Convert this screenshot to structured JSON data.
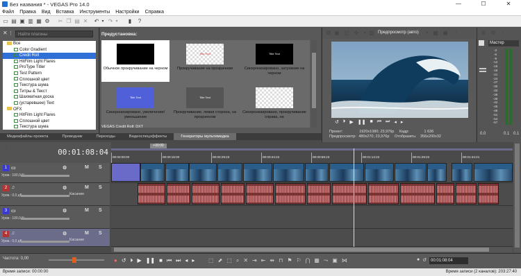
{
  "window": {
    "title": "Без названия * - VEGAS Pro 14.0",
    "controls": [
      "—",
      "☐",
      "✕"
    ]
  },
  "menu": [
    "Файл",
    "Правка",
    "Вид",
    "Вставка",
    "Инструменты",
    "Настройки",
    "Справка"
  ],
  "explorer": {
    "search_placeholder": "Найти плагины",
    "tree": [
      {
        "label": "Все",
        "type": "folder",
        "indent": 1,
        "sel": false
      },
      {
        "label": "Color Gradient",
        "type": "fx",
        "indent": 2,
        "sel": false
      },
      {
        "label": "Credit Roll",
        "type": "fx",
        "indent": 2,
        "sel": true
      },
      {
        "label": "HitFilm Light Flares",
        "type": "fx",
        "indent": 2,
        "sel": false
      },
      {
        "label": "ProType Titler",
        "type": "fx",
        "indent": 2,
        "sel": false
      },
      {
        "label": "Test Pattern",
        "type": "fx",
        "indent": 2,
        "sel": false
      },
      {
        "label": "Сплошной цвет",
        "type": "fx",
        "indent": 2,
        "sel": false
      },
      {
        "label": "Текстура шума",
        "type": "fx",
        "indent": 2,
        "sel": false
      },
      {
        "label": "Титры & Текст",
        "type": "fx",
        "indent": 2,
        "sel": false
      },
      {
        "label": "Шахматная доска",
        "type": "fx",
        "indent": 2,
        "sel": false
      },
      {
        "label": "(устаревшее) Text",
        "type": "fx",
        "indent": 2,
        "sel": false
      },
      {
        "label": "OFX",
        "type": "folder",
        "indent": 1,
        "sel": false
      },
      {
        "label": "HitFilm Light Flares",
        "type": "fx",
        "indent": 2,
        "sel": false
      },
      {
        "label": "Сплошной цвет",
        "type": "fx",
        "indent": 2,
        "sel": false
      },
      {
        "label": "Текстура шума",
        "type": "fx",
        "indent": 2,
        "sel": false
      }
    ]
  },
  "presets": {
    "header": "Предустановка:",
    "status": "VEGAS Credit Roll: DXT",
    "items": [
      {
        "label": "Обычное прокручивание на черном",
        "thumb": "black",
        "thumb_text": "",
        "sel": true
      },
      {
        "label": "Прокручивание на прозрачном",
        "thumb": "checker",
        "thumb_text": "Title Text",
        "sel": false
      },
      {
        "label": "Синхронизировано, затухание на черном",
        "thumb": "black",
        "thumb_text": "Title Text",
        "sel": false
      },
      {
        "label": "Синхронизировано, увеличение/уменьшение",
        "thumb": "blue",
        "thumb_text": "Title Text",
        "sel": false
      },
      {
        "label": "Прокручивание, левая сторона, на прозрачном",
        "thumb": "gray",
        "thumb_text": "Title Text",
        "sel": false
      },
      {
        "label": "Синхронизировано, прокручивание справа, на",
        "thumb": "checker",
        "thumb_text": "",
        "sel": false
      }
    ]
  },
  "tabs": [
    {
      "label": "Медиафайлы проекта",
      "on": false
    },
    {
      "label": "Проводник",
      "on": false
    },
    {
      "label": "Переходы",
      "on": false
    },
    {
      "label": "Видеоспецэффекты",
      "on": false
    },
    {
      "label": "Генераторы мультимедиа",
      "on": true
    }
  ],
  "preview": {
    "mode": "Предпросмотр (авто)",
    "info": {
      "project": "Проект:",
      "project_val": "1920x1080; 23,976p",
      "frame": "Кадр:",
      "frame_val": "1 636",
      "preview": "Предпросмотр:",
      "preview_val": "480x270; 23,976p",
      "display": "Отобразить:",
      "display_val": "356x200x32"
    }
  },
  "master": {
    "label": "Мастер",
    "db_labels": [
      "-3",
      "-6",
      "-9",
      "-12",
      "-15",
      "-18",
      "-21",
      "-24",
      "-27",
      "-30",
      "-33",
      "-36",
      "-39",
      "-42",
      "-45",
      "-48",
      "-51",
      "-54",
      "-57"
    ],
    "bottom_left": "0.0",
    "bottom_right": "0.1",
    "bottom_val": "0.1"
  },
  "timeline": {
    "timecode": "00:01:08:04",
    "marker": "+00:00",
    "ruler": [
      "00:00:00:00",
      "00:00:15:00",
      "00:00:29:23",
      "00:00:44:22",
      "00:00:59:23",
      "00:01:14:22",
      "00:01:29:22",
      "00:01:44:21"
    ]
  },
  "tracks": [
    {
      "num": "1",
      "kind": "video",
      "level": "Уров.: 100,0 %",
      "mode": "",
      "sel": false
    },
    {
      "num": "2",
      "kind": "audio",
      "level": "Уров.: 0,0 дБ",
      "mode": "Касание",
      "sel": false
    },
    {
      "num": "3",
      "kind": "video",
      "level": "Уров.: 100,0 %",
      "mode": "",
      "sel": false
    },
    {
      "num": "4",
      "kind": "audio",
      "level": "Уров.: 0,0 дБ",
      "mode": "Касание",
      "sel": true
    }
  ],
  "bottom": {
    "rate_label": "Частота: 0,00",
    "timecode": "00:01:08:04"
  },
  "statusbar": {
    "left": "Время записи: 00:00:00",
    "right": "Время записи (2 каналов): 203:27:40"
  }
}
